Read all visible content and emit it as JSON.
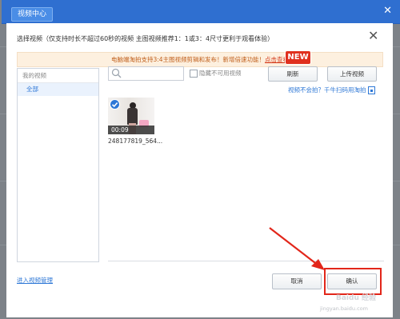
{
  "window": {
    "tab_title": "视频中心",
    "close_glyph": "✕"
  },
  "dialog": {
    "title": "选择视频（仅支持时长不超过60秒的视频 主图视频推荐1：1或3：4尺寸更利于观看体验）",
    "close_glyph": "✕"
  },
  "notice": {
    "text": "电脑端淘拍支持3:4主图视频剪辑和发布！新增倍速功能！",
    "link": "点击查看",
    "badge": "NEW"
  },
  "sidebar": {
    "header": "我的视频",
    "items": [
      {
        "label": "全部",
        "selected": true
      }
    ]
  },
  "toolbar": {
    "search_placeholder": "",
    "hide_unavailable_label": "隐藏不可用视频",
    "hide_unavailable_checked": false,
    "refresh_label": "刷新",
    "upload_label": "上传视频"
  },
  "mobile_link": "视频不会拍？千牛扫码用淘拍",
  "videos": [
    {
      "duration": "00:09",
      "name": "248177819_564...",
      "selected": true
    }
  ],
  "footer": {
    "manage_link": "进入视频管理",
    "cancel_label": "取消",
    "confirm_label": "确认"
  },
  "watermark": {
    "logo": "Baidu 经验",
    "url": "jingyan.baidu.com"
  },
  "colors": {
    "title_bar": "#2f6fd0",
    "link": "#2d77d6",
    "notice_bg": "#fdf0df",
    "notice_text": "#c05e1a",
    "badge": "#e0301e",
    "annotation": "#e2261a"
  },
  "icons": {
    "search": "search-icon",
    "checkmark": "check-circle-icon",
    "mobile": "mobile-icon"
  }
}
